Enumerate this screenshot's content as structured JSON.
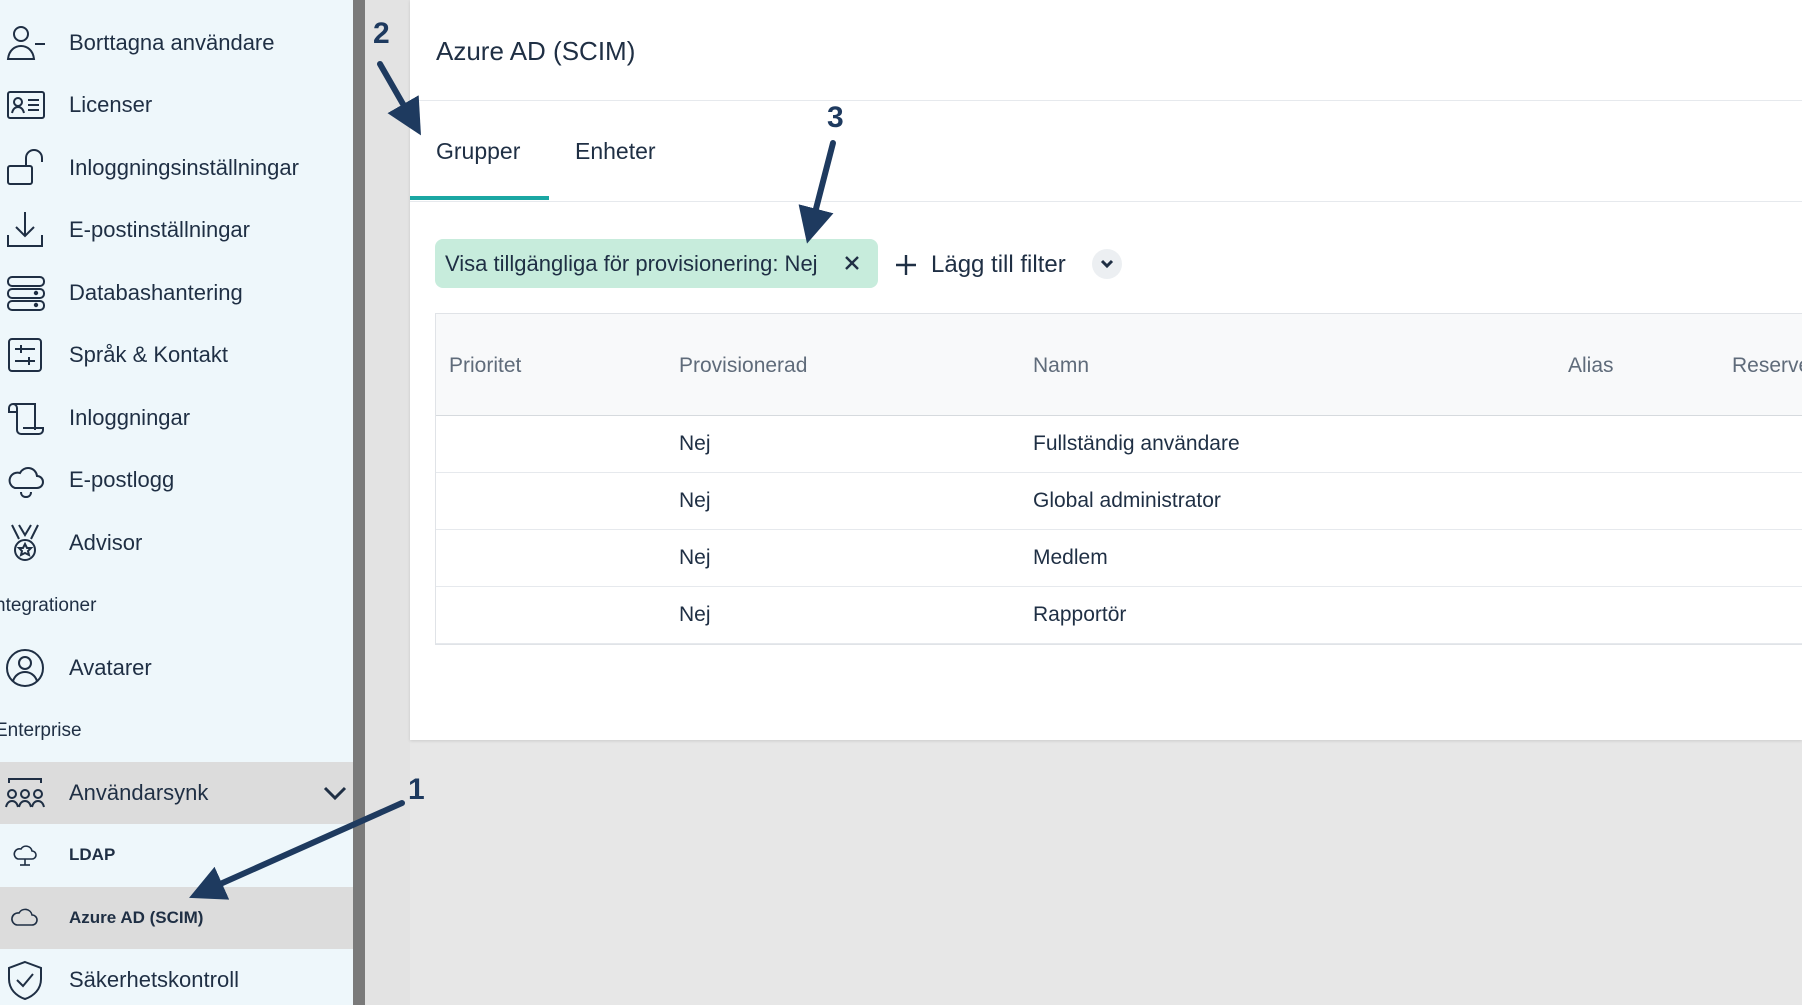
{
  "sidebar": {
    "items": [
      {
        "label": "Borttagna användare",
        "icon": "user-minus-icon"
      },
      {
        "label": "Licenser",
        "icon": "id-card-icon"
      },
      {
        "label": "Inloggningsinställningar",
        "icon": "unlock-icon"
      },
      {
        "label": "E-postinställningar",
        "icon": "download-tray-icon"
      },
      {
        "label": "Databashantering",
        "icon": "server-icon"
      },
      {
        "label": "Språk & Kontakt",
        "icon": "sliders-icon"
      },
      {
        "label": "Inloggningar",
        "icon": "scroll-icon"
      },
      {
        "label": "E-postlogg",
        "icon": "bell-cloud-icon"
      },
      {
        "label": "Advisor",
        "icon": "medal-icon"
      }
    ],
    "section_integrations": "ntegrationer",
    "integrations": [
      {
        "label": "Avatarer",
        "icon": "user-circle-icon"
      }
    ],
    "section_enterprise": "Enterprise",
    "enterprise": {
      "group_label": "Användarsynk",
      "group_icon": "people-group-icon",
      "sub_items": [
        {
          "label": "LDAP",
          "icon": "cloud-network-icon"
        },
        {
          "label": "Azure AD (SCIM)",
          "icon": "cloud-icon"
        }
      ],
      "after": {
        "label": "Säkerhetskontroll",
        "icon": "shield-check-icon"
      }
    }
  },
  "main": {
    "title": "Azure AD (SCIM)",
    "tabs": [
      {
        "label": "Grupper",
        "active": true
      },
      {
        "label": "Enheter",
        "active": false
      }
    ],
    "filter_chip": "Visa tillgängliga för provisionering: Nej",
    "add_filter": "Lägg till filter",
    "table": {
      "columns": [
        "Prioritet",
        "Provisionerad",
        "Namn",
        "Alias",
        "Reserve"
      ],
      "rows": [
        {
          "prioritet": "",
          "provisionerad": "Nej",
          "namn": "Fullständig användare",
          "alias": ""
        },
        {
          "prioritet": "",
          "provisionerad": "Nej",
          "namn": "Global administrator",
          "alias": ""
        },
        {
          "prioritet": "",
          "provisionerad": "Nej",
          "namn": "Medlem",
          "alias": ""
        },
        {
          "prioritet": "",
          "provisionerad": "Nej",
          "namn": "Rapportör",
          "alias": ""
        }
      ]
    }
  },
  "annotations": {
    "one": "1",
    "two": "2",
    "three": "3"
  },
  "colors": {
    "accent": "#1aa7a3",
    "chip_bg": "#c7ecdc",
    "sidebar_bg": "#eef7fb",
    "arrow": "#1e3a5f"
  }
}
